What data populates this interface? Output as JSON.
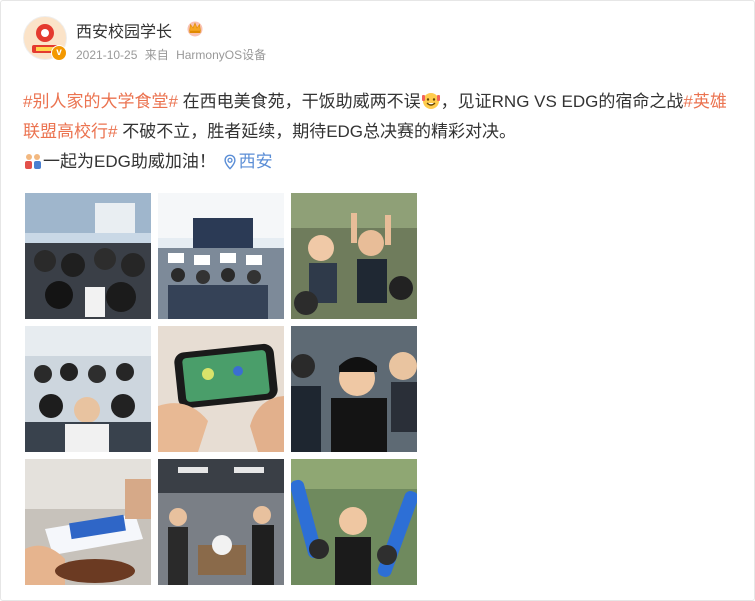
{
  "post": {
    "user_name": "西安校园学长",
    "verified_mark": "v",
    "time": "2021-10-25",
    "source_prefix": "来自",
    "source": "HarmonyOS设备"
  },
  "content": {
    "topic1": "#别人家的大学食堂#",
    "text1": " 在西电美食苑，干饭助威两不误",
    "text2": "，见证RNG VS EDG的宿命之战",
    "topic2": "#英雄联盟高校行#",
    "text3": " 不破不立，胜者延续，期待EDG总决赛的精彩对决。",
    "text4": "一起为EDG助威加油！",
    "location": "西安"
  },
  "icons": {
    "crown": "crown-icon",
    "emoji_cheer": "cheer-emoji-icon",
    "emoji_people": "people-emoji-icon",
    "location": "location-pin-icon"
  },
  "images": {
    "count": 9,
    "descriptions_visible": false
  },
  "colors": {
    "topic": "#eb7350",
    "location": "#5b8ed6",
    "meta": "#999999",
    "verified": "#f39800"
  }
}
